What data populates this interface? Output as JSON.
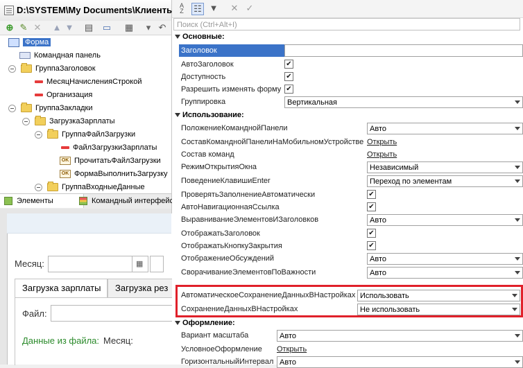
{
  "window": {
    "title": "D:\\SYSTEM\\My Documents\\Клиенты"
  },
  "tree": {
    "items": [
      {
        "label": "Форма",
        "level": 0,
        "icon": "form-icon",
        "selected": true
      },
      {
        "label": "Командная панель",
        "level": 1,
        "icon": "command-panel-icon"
      },
      {
        "label": "ГруппаЗаголовок",
        "level": 1,
        "icon": "folder-icon"
      },
      {
        "label": "МесяцНачисленияСтрокой",
        "level": 2,
        "icon": "field-icon"
      },
      {
        "label": "Организация",
        "level": 2,
        "icon": "field-icon"
      },
      {
        "label": "ГруппаЗакладки",
        "level": 1,
        "icon": "folder-icon"
      },
      {
        "label": "ЗагрузкаЗарплаты",
        "level": 2,
        "icon": "folder-icon"
      },
      {
        "label": "ГруппаФайлЗагрузки",
        "level": 3,
        "icon": "folder-icon"
      },
      {
        "label": "ФайлЗагрузкиЗарплаты",
        "level": 4,
        "icon": "field-icon"
      },
      {
        "label": "ПрочитатьФайлЗагрузки",
        "level": 4,
        "icon": "ok-button-icon"
      },
      {
        "label": "ФормаВыполнитьЗагрузку",
        "level": 4,
        "icon": "ok-button-icon"
      },
      {
        "label": "ГруппаВходныеДанные",
        "level": 3,
        "icon": "folder-icon"
      }
    ]
  },
  "left_tabs": [
    {
      "label": "Элементы",
      "icon": "elements-icon"
    },
    {
      "label": "Командный интерфейс",
      "icon": "command-interface-icon"
    }
  ],
  "preview": {
    "month_label": "Месяц:",
    "tabs": [
      "Загрузка зарплаты",
      "Загрузка рез"
    ],
    "file_label": "Файл:",
    "data_label": "Данные из файла:",
    "month_label2": "Месяц:"
  },
  "search": {
    "placeholder": "Поиск (Ctrl+Alt+I)"
  },
  "properties": {
    "sections": [
      {
        "title": "Основные:",
        "rows": [
          {
            "label": "Заголовок",
            "type": "text",
            "value": "",
            "selected": true
          },
          {
            "label": "АвтоЗаголовок",
            "type": "checkbox",
            "checked": true
          },
          {
            "label": "Доступность",
            "type": "checkbox",
            "checked": true
          },
          {
            "label": "Разрешить изменять форму",
            "type": "checkbox",
            "checked": true
          },
          {
            "label": "Группировка",
            "type": "select",
            "value": "Вертикальная"
          }
        ]
      },
      {
        "title": "Использование:",
        "rows": [
          {
            "label": "ПоложениеКоманднойПанели",
            "type": "select",
            "value": "Авто"
          },
          {
            "label": "СоставКоманднойПанелиНаМобильномУстройстве",
            "type": "link",
            "value": "Открыть"
          },
          {
            "label": "Состав команд",
            "type": "link",
            "value": "Открыть"
          },
          {
            "label": "РежимОткрытияОкна",
            "type": "select",
            "value": "Независимый"
          },
          {
            "label": "ПоведениеКлавишиEnter",
            "type": "select",
            "value": "Переход по элементам"
          },
          {
            "label": "ПроверятьЗаполнениеАвтоматически",
            "type": "checkbox",
            "checked": true
          },
          {
            "label": "АвтоНавигационнаяСсылка",
            "type": "checkbox",
            "checked": true
          },
          {
            "label": "ВыравниваниеЭлементовИЗаголовков",
            "type": "select",
            "value": "Авто"
          },
          {
            "label": "ОтображатьЗаголовок",
            "type": "checkbox",
            "checked": true
          },
          {
            "label": "ОтображатьКнопкуЗакрытия",
            "type": "checkbox",
            "checked": true
          },
          {
            "label": "ОтображениеОбсуждений",
            "type": "select",
            "value": "Авто"
          },
          {
            "label": "СворачиваниеЭлементовПоВажности",
            "type": "select",
            "value": "Авто"
          },
          {
            "label": "АвтоматическоеСохранениеДанныхВНастройках",
            "type": "select",
            "value": "Использовать"
          },
          {
            "label": "СохранениеДанныхВНастройках",
            "type": "select",
            "value": "Не использовать"
          }
        ]
      },
      {
        "title": "Оформление:",
        "rows": [
          {
            "label": "Вариант масштаба",
            "type": "select",
            "value": "Авто"
          },
          {
            "label": "УсловноеОформление",
            "type": "link",
            "value": "Открыть"
          },
          {
            "label": "ГоризонтальныйИнтервал",
            "type": "select",
            "value": "Авто"
          }
        ]
      }
    ]
  },
  "colors": {
    "selection": "#3b73c8",
    "highlight_border": "#e0202a",
    "link": "#1a1a1a"
  }
}
